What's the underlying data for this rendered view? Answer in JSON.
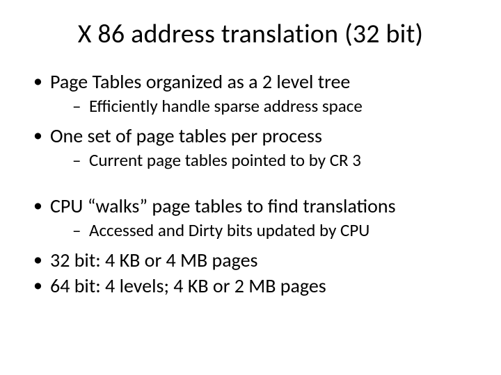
{
  "title": "X 86 address translation (32 bit)",
  "bullets": {
    "b0": "Page Tables organized as a 2 level tree",
    "b0s0": "Efficiently handle sparse address space",
    "b1": "One set of page tables per process",
    "b1s0": "Current page tables pointed to by CR 3",
    "b2": "CPU “walks” page tables to find translations",
    "b2s0": "Accessed and Dirty bits updated by CPU",
    "b3": "32 bit: 4 KB or 4 MB pages",
    "b4": "64 bit: 4 levels; 4 KB or 2 MB pages"
  }
}
